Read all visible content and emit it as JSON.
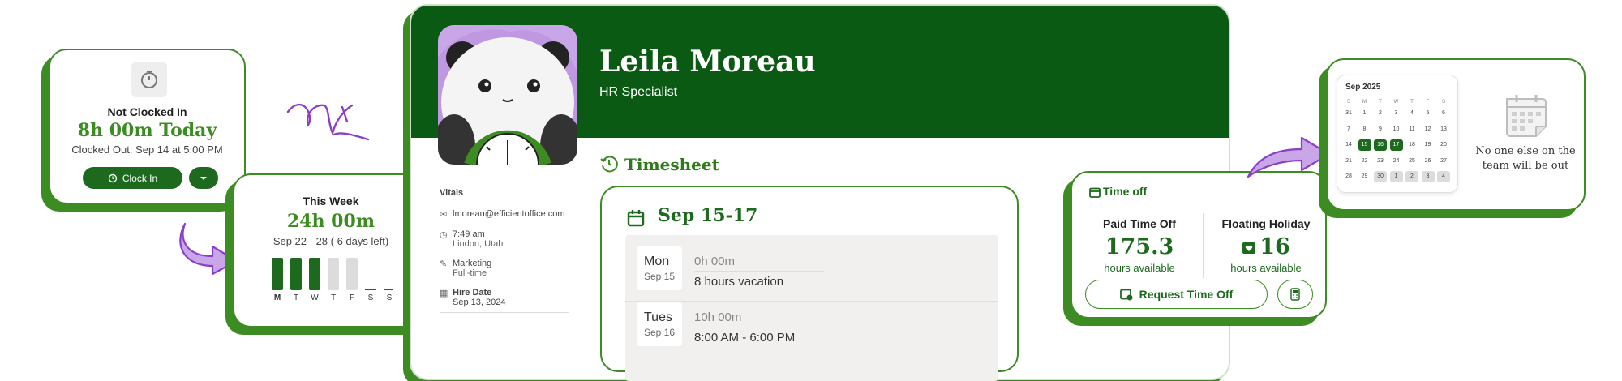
{
  "clock": {
    "status": "Not Clocked In",
    "today": "8h 00m Today",
    "clocked_out": "Clocked Out: Sep 14 at 5:00 PM",
    "clock_in_label": "Clock In"
  },
  "week": {
    "title": "This Week",
    "hours": "24h 00m",
    "range": "Sep 22 - 28 ( 6 days left)",
    "days": [
      {
        "label": "M",
        "level": 1.0,
        "state": "done"
      },
      {
        "label": "T",
        "level": 1.0,
        "state": "done"
      },
      {
        "label": "W",
        "level": 1.0,
        "state": "done"
      },
      {
        "label": "T",
        "level": 1.0,
        "state": "upcoming"
      },
      {
        "label": "F",
        "level": 1.0,
        "state": "upcoming"
      },
      {
        "label": "S",
        "level": 0.0,
        "state": "off"
      },
      {
        "label": "S",
        "level": 0.0,
        "state": "off"
      }
    ]
  },
  "profile": {
    "name": "Leila Moreau",
    "role": "HR Specialist",
    "timesheet_label": "Timesheet",
    "vitals": {
      "heading": "Vitals",
      "email": "lmoreau@efficientoffice.com",
      "time": "7:49 am",
      "location": "Lindon, Utah",
      "department": "Marketing",
      "employment": "Full-time",
      "hire_label": "Hire Date",
      "hire_date": "Sep 13, 2024"
    }
  },
  "timesheet": {
    "range": "Sep 15-17",
    "entries": [
      {
        "dow": "Mon",
        "date": "Sep 15",
        "hours": "0h 00m",
        "desc": "8 hours vacation"
      },
      {
        "dow": "Tues",
        "date": "Sep 16",
        "hours": "10h 00m",
        "desc": "8:00 AM - 6:00 PM"
      }
    ]
  },
  "time_off": {
    "heading": "Time off",
    "pto_label": "Paid Time Off",
    "pto_value": "175.3",
    "pto_sub": "hours available",
    "fh_label": "Floating Holiday",
    "fh_value": "16",
    "fh_sub": "hours available",
    "request_label": "Request Time Off"
  },
  "calendar": {
    "month": "Sep 2025",
    "weekdays": [
      "S",
      "M",
      "T",
      "W",
      "T",
      "F",
      "S"
    ],
    "weeks": [
      [
        "31",
        "1",
        "2",
        "3",
        "4",
        "5",
        "6"
      ],
      [
        "7",
        "8",
        "9",
        "10",
        "11",
        "12",
        "13"
      ],
      [
        "14",
        "15",
        "16",
        "17",
        "18",
        "19",
        "20"
      ],
      [
        "21",
        "22",
        "23",
        "24",
        "25",
        "26",
        "27"
      ],
      [
        "28",
        "29",
        "30",
        "1",
        "2",
        "3",
        "4"
      ]
    ],
    "selected": [
      "15",
      "16",
      "17"
    ],
    "message": "No one else on the team will be out"
  },
  "colors": {
    "brand_dark": "#0b5a14",
    "brand": "#3d8c23",
    "accent_purple": "#c9a6e8"
  }
}
